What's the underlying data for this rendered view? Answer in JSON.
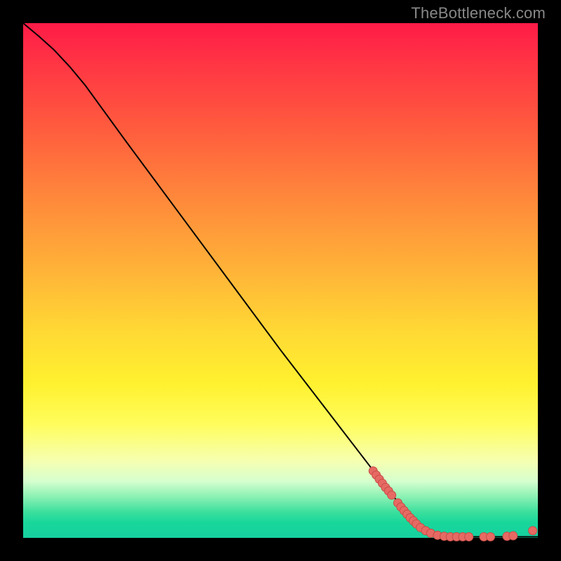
{
  "watermark": "TheBottleneck.com",
  "chart_data": {
    "type": "line",
    "title": "",
    "xlabel": "",
    "ylabel": "",
    "xlim": [
      0,
      100
    ],
    "ylim": [
      0,
      100
    ],
    "grid": false,
    "series": [
      {
        "name": "curve",
        "style": "line-black",
        "points": [
          {
            "x": 0,
            "y": 100
          },
          {
            "x": 3,
            "y": 97.5
          },
          {
            "x": 6,
            "y": 94.8
          },
          {
            "x": 9,
            "y": 91.6
          },
          {
            "x": 12,
            "y": 88.0
          },
          {
            "x": 20,
            "y": 77.0
          },
          {
            "x": 30,
            "y": 63.5
          },
          {
            "x": 40,
            "y": 50.0
          },
          {
            "x": 50,
            "y": 36.5
          },
          {
            "x": 60,
            "y": 23.5
          },
          {
            "x": 70,
            "y": 10.5
          },
          {
            "x": 76,
            "y": 3.0
          },
          {
            "x": 79,
            "y": 1.2
          },
          {
            "x": 82,
            "y": 0.4
          },
          {
            "x": 86,
            "y": 0.2
          },
          {
            "x": 90,
            "y": 0.2
          },
          {
            "x": 95,
            "y": 0.2
          },
          {
            "x": 100,
            "y": 0.2
          }
        ]
      },
      {
        "name": "markers",
        "style": "dots-salmon",
        "points": [
          {
            "x": 68.0,
            "y": 13.0
          },
          {
            "x": 68.6,
            "y": 12.2
          },
          {
            "x": 69.2,
            "y": 11.4
          },
          {
            "x": 69.8,
            "y": 10.6
          },
          {
            "x": 70.4,
            "y": 9.8
          },
          {
            "x": 71.0,
            "y": 9.1
          },
          {
            "x": 71.6,
            "y": 8.3
          },
          {
            "x": 72.8,
            "y": 6.8
          },
          {
            "x": 73.4,
            "y": 6.0
          },
          {
            "x": 74.0,
            "y": 5.3
          },
          {
            "x": 74.6,
            "y": 4.6
          },
          {
            "x": 75.2,
            "y": 3.9
          },
          {
            "x": 75.8,
            "y": 3.3
          },
          {
            "x": 76.4,
            "y": 2.7
          },
          {
            "x": 77.2,
            "y": 2.0
          },
          {
            "x": 78.2,
            "y": 1.4
          },
          {
            "x": 79.2,
            "y": 0.9
          },
          {
            "x": 80.5,
            "y": 0.5
          },
          {
            "x": 81.8,
            "y": 0.3
          },
          {
            "x": 83.0,
            "y": 0.2
          },
          {
            "x": 84.2,
            "y": 0.2
          },
          {
            "x": 85.4,
            "y": 0.2
          },
          {
            "x": 86.6,
            "y": 0.2
          },
          {
            "x": 89.5,
            "y": 0.2
          },
          {
            "x": 90.8,
            "y": 0.2
          },
          {
            "x": 94.0,
            "y": 0.3
          },
          {
            "x": 95.2,
            "y": 0.4
          },
          {
            "x": 99.0,
            "y": 1.4
          }
        ]
      }
    ],
    "colors": {
      "curve": "#000000",
      "marker_fill": "#e66a63",
      "marker_stroke": "#c74c46",
      "axes_bg_top": "#ff1b47",
      "axes_bg_bottom": "#16d0a0",
      "page_bg": "#000000"
    }
  }
}
